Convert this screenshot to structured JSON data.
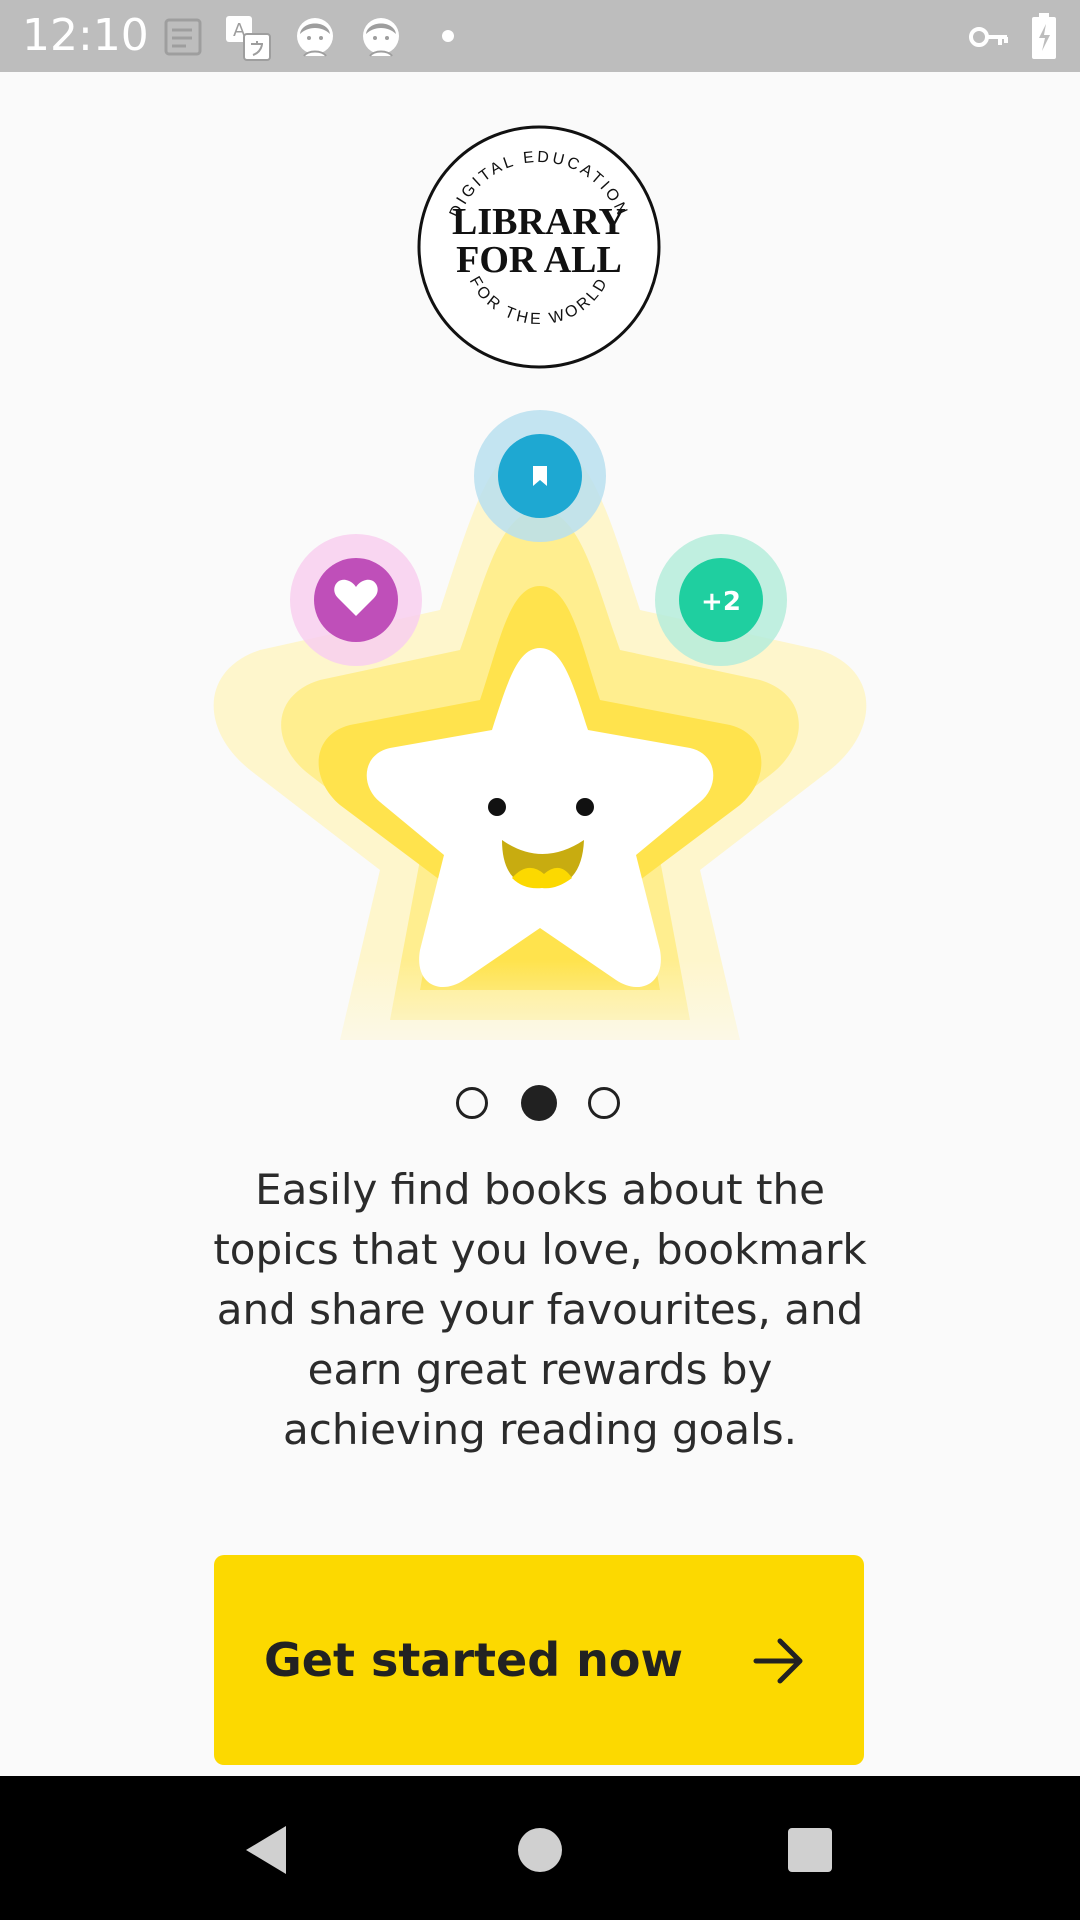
{
  "status_bar": {
    "time": "12:10",
    "icons": [
      "notes-icon",
      "translate-icon",
      "avatar-icon",
      "avatar-icon",
      "dot-icon",
      "vpn-key-icon",
      "battery-charging-icon"
    ]
  },
  "logo": {
    "top_arc": "DIGITAL EDUCATION",
    "line1": "LIBRARY",
    "line2": "FOR ALL",
    "bottom_arc": "FOR THE WORLD"
  },
  "illustration": {
    "badges": {
      "favourite_icon": "heart-icon",
      "bookmark_icon": "bookmark-icon",
      "points_label": "+2"
    },
    "colors": {
      "heart": "#bf4fb9",
      "bookmark": "#1ea8d2",
      "points": "#1fcfa0",
      "star_glow": "#ffe34d"
    }
  },
  "pager": {
    "count": 3,
    "active_index": 1
  },
  "description": {
    "line1": "Easily find books about the",
    "line2": "topics that you love, bookmark",
    "line3": "and share your favourites, and",
    "line4": "earn great rewards by",
    "line5": "achieving reading goals."
  },
  "cta": {
    "label": "Get started now",
    "icon": "arrow-right-icon",
    "color": "#fcd900"
  },
  "nav_bar": {
    "buttons": [
      "back-icon",
      "home-icon",
      "recents-icon"
    ]
  }
}
